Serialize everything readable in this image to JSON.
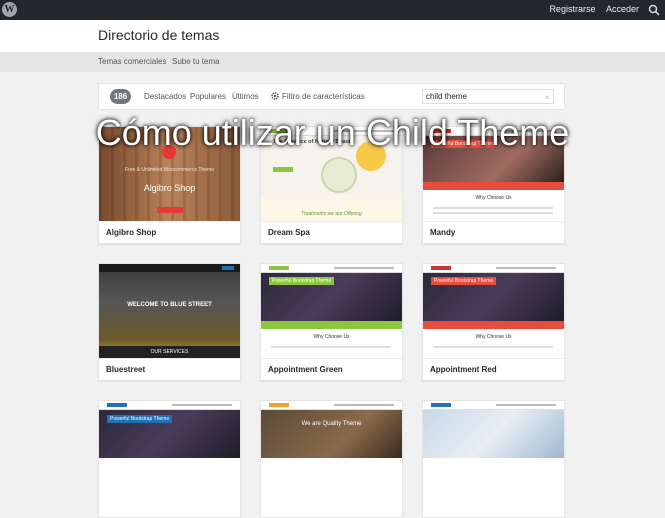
{
  "adminbar": {
    "register": "Registrarse",
    "login": "Acceder"
  },
  "header": {
    "title": "Directorio de temas"
  },
  "subnav": {
    "commercial": "Temas comerciales",
    "upload": "Sube tu tema"
  },
  "filter": {
    "count": "186",
    "tabs": [
      "Destacados",
      "Populares",
      "Últimos"
    ],
    "features": "Filtro de características",
    "search_value": "child theme"
  },
  "overlay": {
    "title": "Cómo utilizar un Child Theme"
  },
  "themes": [
    {
      "name": "Algibro Shop",
      "shot_title": "Algibro Shop",
      "shot_tag": "Free & Unlimited Woocommerce Theme"
    },
    {
      "name": "Dream Spa",
      "shot_title": "The Essence of Natural Beauty",
      "shot_tag": "Treatments we are Offering"
    },
    {
      "name": "Mandy",
      "shot_title": "Powerful Bootstrap Theme",
      "shot_tag": "Why Choose Us"
    },
    {
      "name": "Bluestreet",
      "shot_title": "WELCOME TO BLUE STREET",
      "shot_tag": "OUR SERVICES"
    },
    {
      "name": "Appointment Green",
      "shot_title": "Powerful Bootstrap Theme",
      "shot_tag": "Why Choose Us"
    },
    {
      "name": "Appointment Red",
      "shot_title": "Powerful Bootstrap Theme",
      "shot_tag": "Why Choose Us"
    },
    {
      "name": "",
      "shot_title": "Powerful Bootstrap Theme",
      "shot_tag": ""
    },
    {
      "name": "",
      "shot_title": "We are Quality Theme",
      "shot_tag": ""
    },
    {
      "name": "",
      "shot_title": "",
      "shot_tag": ""
    }
  ],
  "colors": {
    "adminbar": "#23282d",
    "accent_green": "#8cc63f",
    "accent_red": "#e84c3d",
    "accent_blue": "#2270b6"
  }
}
